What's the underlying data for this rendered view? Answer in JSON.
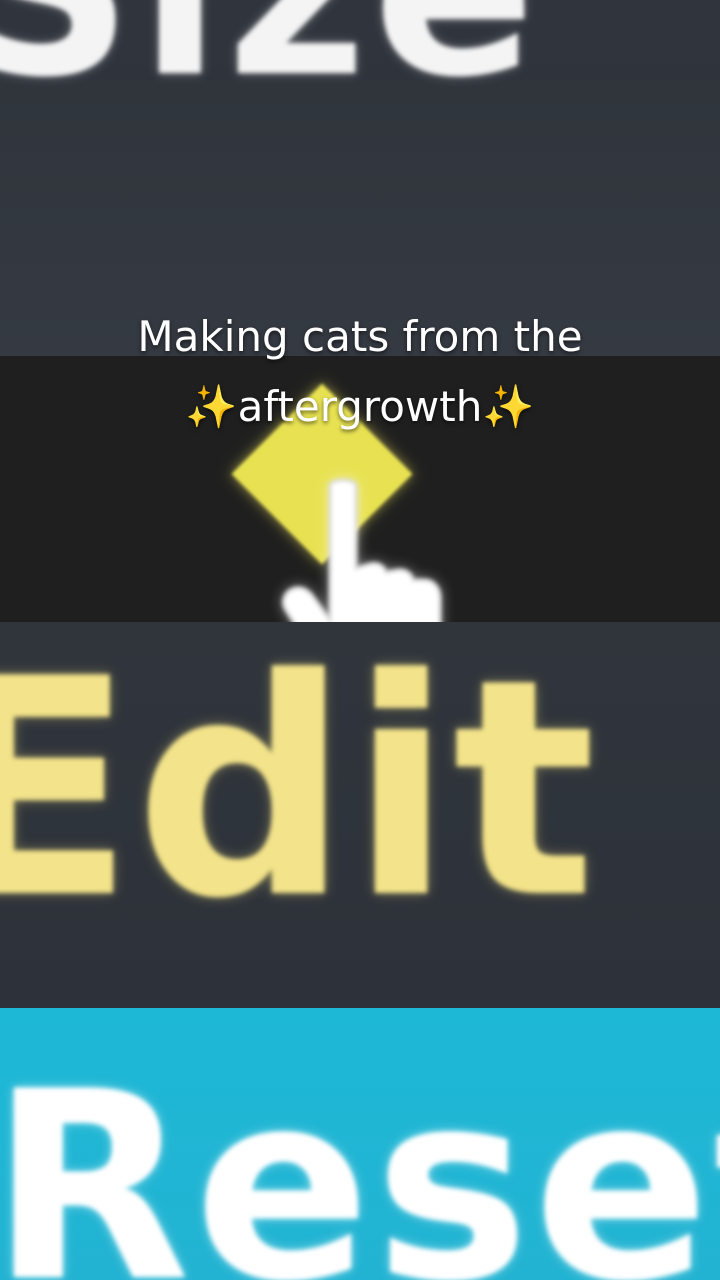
{
  "screen": {
    "size_heading": "Size",
    "edit_label": "Edit",
    "reset_button": {
      "label": "Reset"
    }
  },
  "caption": {
    "line1": "Making cats from the",
    "line2_prefix": "✨",
    "line2_text": "aftergrowth",
    "line2_suffix": "✨"
  },
  "icons": {
    "selected_item": "yellow-diamond-icon",
    "cursor": "pointer-hand-icon",
    "sparkles": "sparkles-emoji"
  },
  "colors": {
    "background": "#2c3139",
    "selected_band": "#1f1f1f",
    "diamond": "#e8e252",
    "edit_text": "#f3e38a",
    "reset_button": "#1db8d6",
    "reset_text": "#ffffff",
    "caption_text": "#ffffff"
  }
}
